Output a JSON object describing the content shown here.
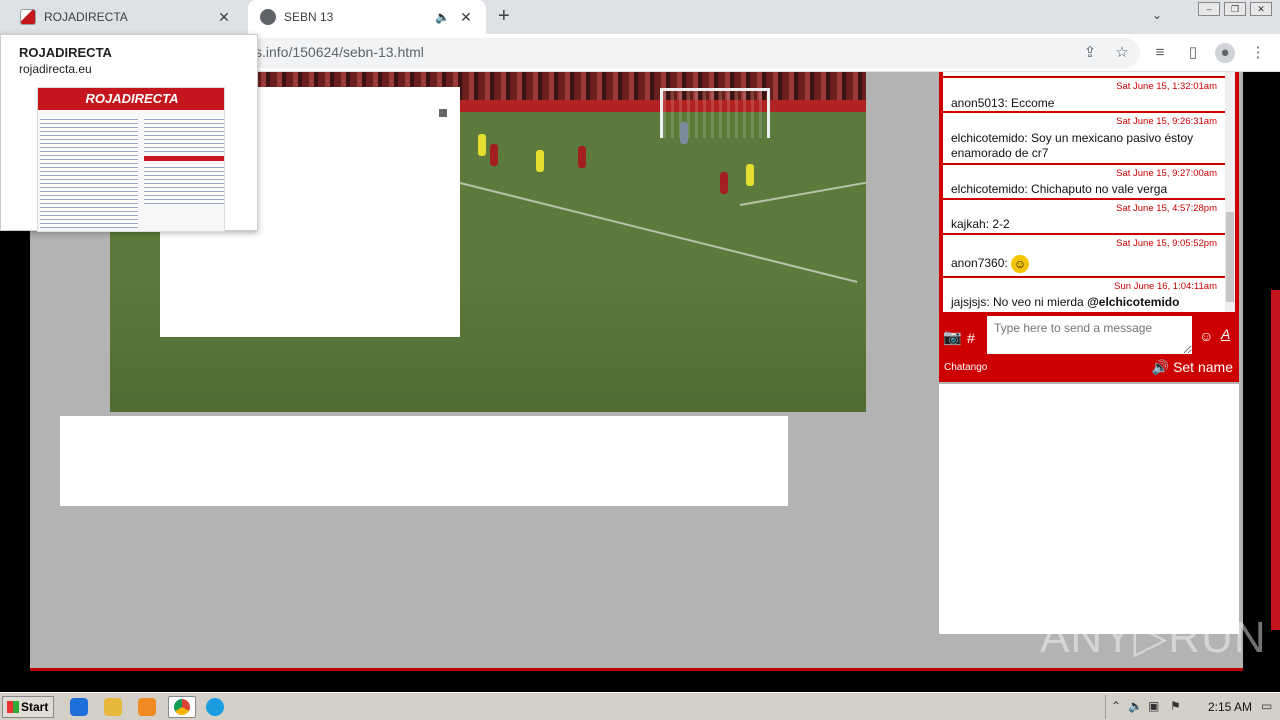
{
  "browser": {
    "tabs": [
      {
        "title": "ROJADIRECTA",
        "active": false
      },
      {
        "title": "SEBN 13",
        "active": true
      }
    ],
    "url": "s.info/150624/sebn-13.html",
    "preview": {
      "title": "ROJADIRECTA",
      "domain": "rojadirecta.eu",
      "logo_text": "ROJADIRECTA"
    }
  },
  "chat": {
    "messages": [
      {
        "time": "Sat June 15, 1:32:01am",
        "text": "anon5013: Eccome"
      },
      {
        "time": "Sat June 15, 9:26:31am",
        "text": "elchicotemido: Soy un mexicano pasivo éstoy enamorado de cr7"
      },
      {
        "time": "Sat June 15, 9:27:00am",
        "text": "elchicotemido: Chichaputo no vale verga"
      },
      {
        "time": "Sat June 15, 4:57:28pm",
        "text": "kajkah: 2-2"
      },
      {
        "time": "Sat June 15, 9:05:52pm",
        "text": "anon7360:"
      },
      {
        "time": "Sun June 16, 1:04:11am",
        "text": "jajsjsjs: No veo ni mierda ",
        "mention": "@elchicotemido"
      }
    ],
    "input_placeholder": "Type here to send a message",
    "brand": "Chatango",
    "set_name": "Set name"
  },
  "watermark": "ANY▷RUN",
  "taskbar": {
    "start": "Start",
    "clock": "2:15 AM"
  }
}
